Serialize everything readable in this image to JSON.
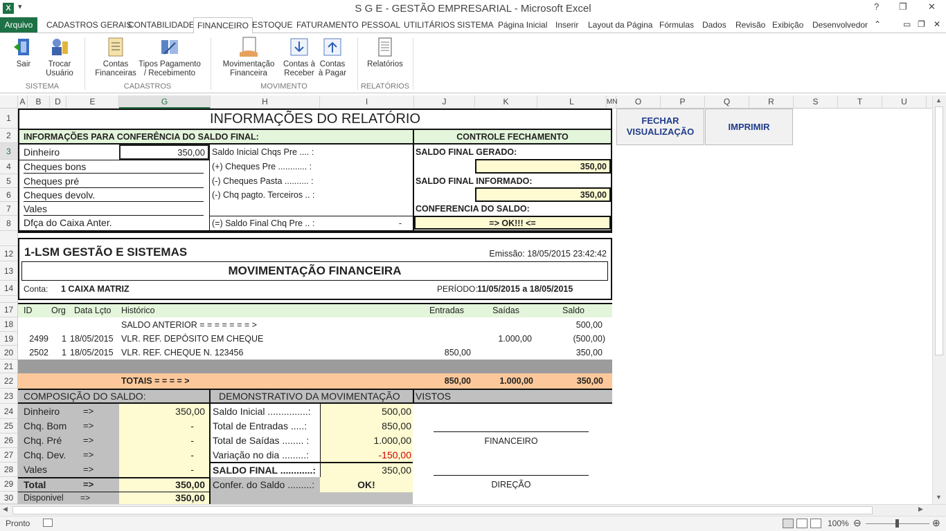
{
  "window": {
    "title": "S G E - GESTÃO EMPRESARIAL  -  Microsoft Excel",
    "qat": "▾"
  },
  "ribbon_tabs": [
    "Arquivo",
    "CADASTROS GERAIS",
    "CONTABILIDADE",
    "FINANCEIRO",
    "ESTOQUE",
    "FATURAMENTO",
    "PESSOAL",
    "UTILITÁRIOS",
    "SISTEMA",
    "Página Inicial",
    "Inserir",
    "Layout da Página",
    "Fórmulas",
    "Dados",
    "Revisão",
    "Exibição",
    "Desenvolvedor"
  ],
  "ribbon": {
    "buttons": [
      {
        "l1": "Sair",
        "l2": ""
      },
      {
        "l1": "Trocar",
        "l2": "Usuário"
      },
      {
        "l1": "Contas",
        "l2": "Financeiras"
      },
      {
        "l1": "Tipos Pagamento",
        "l2": "/ Recebimento"
      },
      {
        "l1": "Movimentação",
        "l2": "Financeira"
      },
      {
        "l1": "Contas à",
        "l2": "Receber"
      },
      {
        "l1": "Contas",
        "l2": "à Pagar"
      },
      {
        "l1": "Relatórios",
        "l2": ""
      }
    ],
    "groups": [
      "SISTEMA",
      "CADASTROS",
      "MOVIMENTO",
      "RELATÓRIOS"
    ]
  },
  "columns": [
    "A",
    "B",
    "D",
    "E",
    "G",
    "H",
    "I",
    "J",
    "K",
    "L",
    "MN",
    "O",
    "P",
    "Q",
    "R",
    "S",
    "T",
    "U"
  ],
  "rows": [
    "1",
    "2",
    "3",
    "4",
    "5",
    "6",
    "7",
    "8",
    "12",
    "13",
    "14",
    "17",
    "18",
    "19",
    "20",
    "21",
    "22",
    "23",
    "24",
    "25",
    "26",
    "27",
    "28",
    "29",
    "30"
  ],
  "buttons": {
    "close": "FECHAR\nVISUALIZAÇÃO",
    "close_l1": "FECHAR",
    "close_l2": "VISUALIZAÇÃO",
    "print": "IMPRIMIR"
  },
  "report_info": {
    "title": "INFORMAÇÕES DO RELATÓRIO",
    "conf_header": "INFORMAÇÕES PARA CONFERÊNCIA DO SALDO FINAL:",
    "ctrl_header": "CONTROLE FECHAMENTO",
    "left_labels": [
      "Dinheiro",
      "Cheques bons",
      "Cheques pré",
      "Cheques devolv.",
      "Vales",
      "Dfça do Caixa Anter."
    ],
    "dinheiro_value": "350,00",
    "mid_labels": [
      "Saldo Inicial Chqs Pre .... :",
      "(+) Cheques Pre ............ :",
      "(-) Cheques Pasta .......... :",
      "(-) Chq pagto. Terceiros .. :"
    ],
    "saldo_final_chq_label": "(=) Saldo Final Chq Pre .. :",
    "saldo_final_chq_value": "-",
    "saldo_gerado_label": "SALDO FINAL GERADO:",
    "saldo_gerado_value": "350,00",
    "saldo_informado_label": "SALDO FINAL INFORMADO:",
    "saldo_informado_value": "350,00",
    "conferencia_label": "CONFERENCIA DO SALDO:",
    "conferencia_value": "=> OK!!! <="
  },
  "report": {
    "company": "1-LSM GESTÃO E SISTEMAS",
    "emissao": "Emissão: 18/05/2015 23:42:42",
    "title": "MOVIMENTAÇÃO FINANCEIRA",
    "conta_label": "Conta:",
    "conta_value": "1  CAIXA MATRIZ",
    "periodo_label": "PERÍODO:",
    "periodo_value": "11/05/2015 a 18/05/2015",
    "headers": {
      "id": "ID",
      "org": "Org",
      "data": "Data Lçto",
      "hist": "Histórico",
      "entradas": "Entradas",
      "saidas": "Saídas",
      "saldo": "Saldo"
    },
    "saldo_anterior_label": "SALDO ANTERIOR = = = = = = = >",
    "saldo_anterior_value": "500,00",
    "lines": [
      {
        "id": "2499",
        "org": "1",
        "data": "18/05/2015",
        "hist": "VLR. REF. DEPÓSITO EM CHEQUE",
        "entradas": "",
        "saidas": "1.000,00",
        "saldo": "(500,00)"
      },
      {
        "id": "2502",
        "org": "1",
        "data": "18/05/2015",
        "hist": "VLR. REF. CHEQUE N. 123456",
        "entradas": "850,00",
        "saidas": "",
        "saldo": "350,00"
      }
    ],
    "totais_label": "TOTAIS    = = = = >",
    "tot_entradas": "850,00",
    "tot_saidas": "1.000,00",
    "tot_saldo": "350,00"
  },
  "composicao": {
    "header": "COMPOSIÇÃO DO SALDO:",
    "items": [
      {
        "label": "Dinheiro",
        "arrow": "=>",
        "value": "350,00"
      },
      {
        "label": "Chq. Bom",
        "arrow": "=>",
        "value": "-"
      },
      {
        "label": "Chq. Pré",
        "arrow": "=>",
        "value": "-"
      },
      {
        "label": "Chq. Dev.",
        "arrow": "=>",
        "value": "-"
      },
      {
        "label": "Vales",
        "arrow": "=>",
        "value": "-"
      }
    ],
    "total_label": "Total",
    "total_arrow": "=>",
    "total_value": "350,00",
    "disp_label": "Disponivel",
    "disp_arrow": "=>",
    "disp_value": "350,00"
  },
  "demonstrativo": {
    "header": "DEMONSTRATIVO DA MOVIMENTAÇÃO",
    "items": [
      {
        "label": "Saldo Inicial ...............:",
        "value": "500,00"
      },
      {
        "label": "Total de Entradas .....:",
        "value": "850,00"
      },
      {
        "label": "Total de Saídas ........ :",
        "value": "1.000,00"
      },
      {
        "label": "Variação no dia .........:",
        "value": "-150,00"
      },
      {
        "label": "SALDO FINAL ............:",
        "value": "350,00"
      },
      {
        "label": "Confer. do Saldo .........:",
        "value": "OK!"
      }
    ],
    "negative_color": "#d00000"
  },
  "vistos": {
    "header": "VISTOS",
    "sig1": "FINANCEIRO",
    "sig2": "DIREÇÃO"
  },
  "status": {
    "ready": "Pronto",
    "zoom": "100%"
  },
  "colors": {
    "accent": "#217346",
    "light_yellow": "#fefbd2",
    "mint": "#e3f5da",
    "orange": "#fcc89b",
    "gray": "#c0c0c0"
  }
}
